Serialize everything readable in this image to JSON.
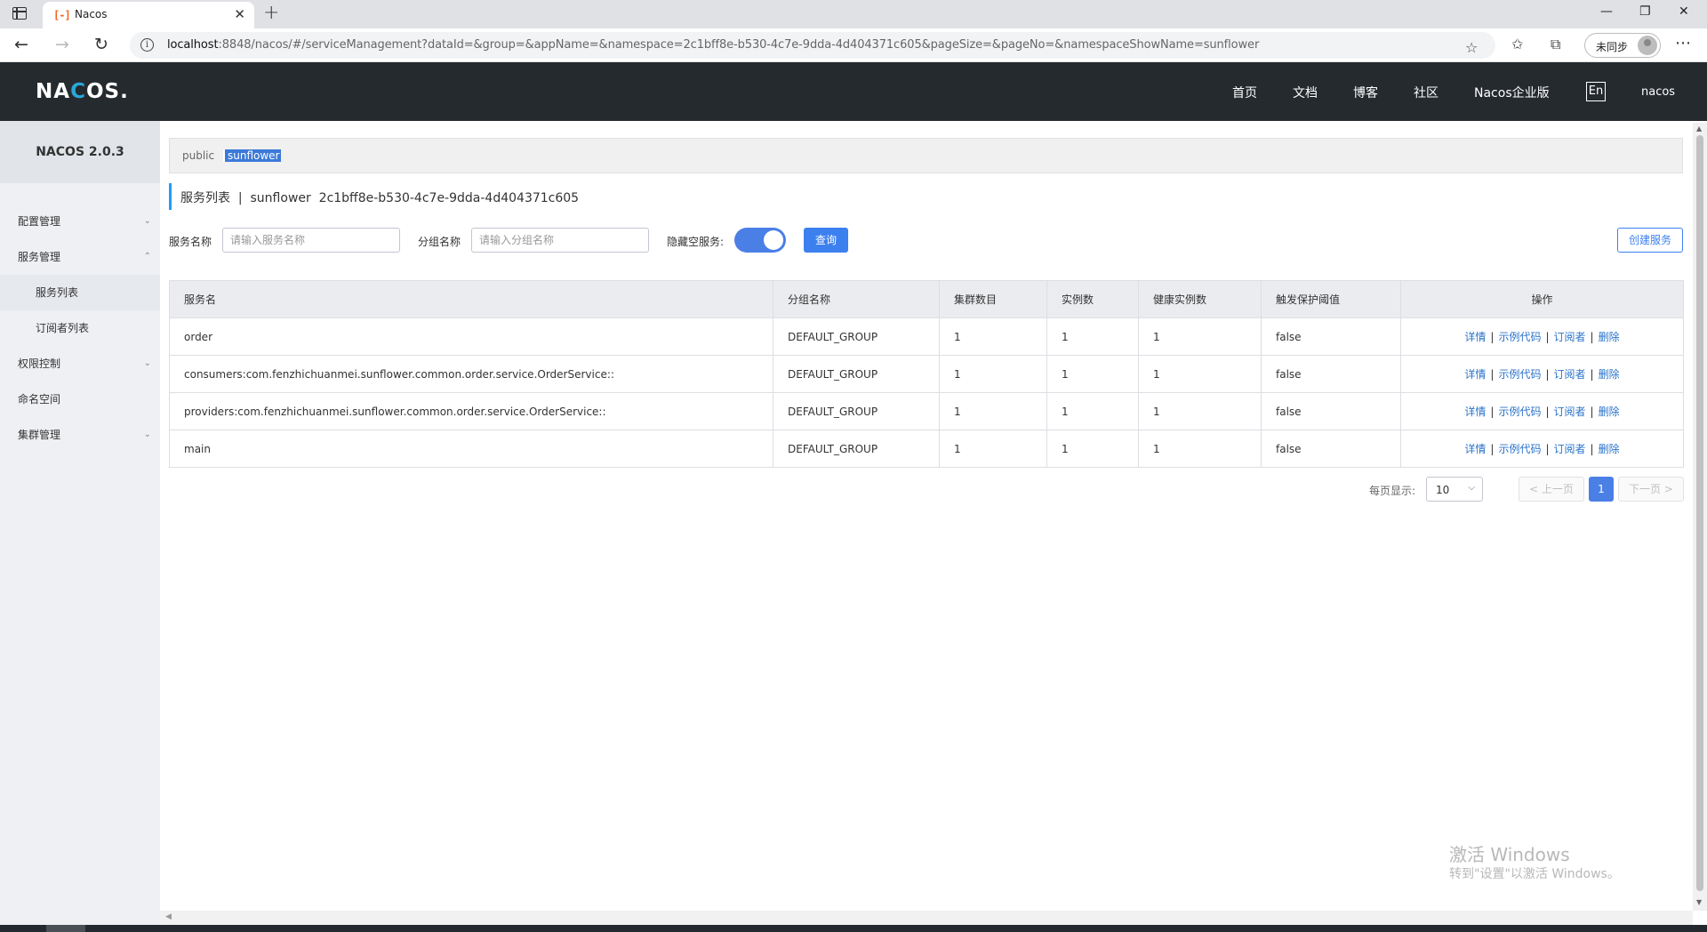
{
  "browser": {
    "tab_title": "Nacos",
    "favicon": "[-]",
    "url_host": "localhost",
    "url_rest": ":8848/nacos/#/serviceManagement?dataId=&group=&appName=&namespace=2c1bff8e-b530-4c7e-9dda-4d404371c605&pageSize=&pageNo=&namespaceShowName=sunflower",
    "profile_label": "未同步"
  },
  "header": {
    "logo_pre": "NA",
    "logo_o": "C",
    "logo_post": "OS.",
    "nav": [
      "首页",
      "文档",
      "博客",
      "社区",
      "Nacos企业版"
    ],
    "lang": "En",
    "user": "nacos"
  },
  "sidebar": {
    "version": "NACOS 2.0.3",
    "items": [
      {
        "label": "配置管理",
        "chevron": "⌄"
      },
      {
        "label": "服务管理",
        "chevron": "⌃"
      },
      {
        "label": "服务列表"
      },
      {
        "label": "订阅者列表"
      },
      {
        "label": "权限控制",
        "chevron": "⌄"
      },
      {
        "label": "命名空间"
      },
      {
        "label": "集群管理",
        "chevron": "⌄"
      }
    ]
  },
  "namespace": {
    "public": "public",
    "active": "sunflower"
  },
  "title": {
    "text": "服务列表  |  sunflower  2c1bff8e-b530-4c7e-9dda-4d404371c605"
  },
  "filters": {
    "service_label": "服务名称",
    "service_placeholder": "请输入服务名称",
    "group_label": "分组名称",
    "group_placeholder": "请输入分组名称",
    "hide_empty_label": "隐藏空服务:",
    "query_btn": "查询",
    "create_btn": "创建服务"
  },
  "table": {
    "headers": [
      "服务名",
      "分组名称",
      "集群数目",
      "实例数",
      "健康实例数",
      "触发保护阈值",
      "操作"
    ],
    "rows": [
      {
        "name": "order",
        "group": "DEFAULT_GROUP",
        "clusters": "1",
        "instances": "1",
        "healthy": "1",
        "protect": "false"
      },
      {
        "name": "consumers:com.fenzhichuanmei.sunflower.common.order.service.OrderService::",
        "group": "DEFAULT_GROUP",
        "clusters": "1",
        "instances": "1",
        "healthy": "1",
        "protect": "false"
      },
      {
        "name": "providers:com.fenzhichuanmei.sunflower.common.order.service.OrderService::",
        "group": "DEFAULT_GROUP",
        "clusters": "1",
        "instances": "1",
        "healthy": "1",
        "protect": "false"
      },
      {
        "name": "main",
        "group": "DEFAULT_GROUP",
        "clusters": "1",
        "instances": "1",
        "healthy": "1",
        "protect": "false"
      }
    ],
    "ops": [
      "详情",
      "示例代码",
      "订阅者",
      "删除"
    ]
  },
  "pagination": {
    "size_label": "每页显示:",
    "size_value": "10",
    "prev": "< 上一页",
    "current": "1",
    "next": "下一页 >"
  },
  "watermark": {
    "title": "激活 Windows",
    "sub": "转到\"设置\"以激活 Windows。"
  },
  "colors": {
    "header_bg": "#252a2f",
    "accent": "#3c80f0",
    "link": "#2a73c9"
  }
}
